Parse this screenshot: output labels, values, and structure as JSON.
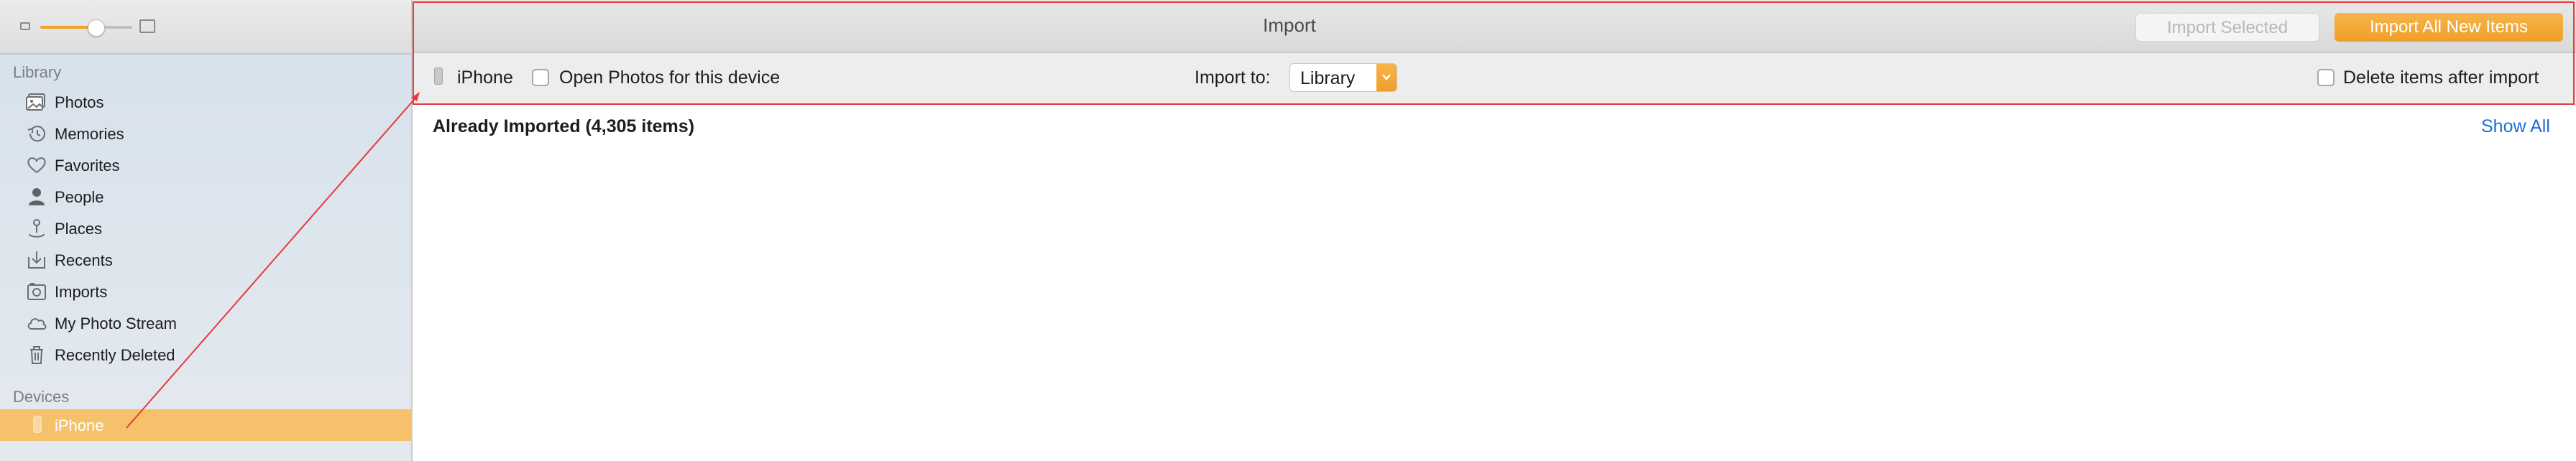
{
  "sidebar": {
    "sections": {
      "library": "Library",
      "devices": "Devices"
    },
    "library_items": [
      {
        "label": "Photos",
        "icon": "photos-icon"
      },
      {
        "label": "Memories",
        "icon": "memories-icon"
      },
      {
        "label": "Favorites",
        "icon": "heart-icon"
      },
      {
        "label": "People",
        "icon": "person-icon"
      },
      {
        "label": "Places",
        "icon": "pin-icon"
      },
      {
        "label": "Recents",
        "icon": "recents-icon"
      },
      {
        "label": "Imports",
        "icon": "imports-icon"
      },
      {
        "label": "My Photo Stream",
        "icon": "cloud-icon"
      },
      {
        "label": "Recently Deleted",
        "icon": "trash-icon"
      }
    ],
    "device_items": [
      {
        "label": "iPhone",
        "icon": "phone-icon",
        "selected": true
      }
    ],
    "zoom_level": 0.6
  },
  "header": {
    "title": "Import",
    "import_selected_label": "Import Selected",
    "import_all_label": "Import All New Items"
  },
  "toolbar": {
    "device_name": "iPhone",
    "open_photos_label": "Open Photos for this device",
    "import_to_label": "Import to:",
    "import_to_value": "Library",
    "delete_label": "Delete items after import"
  },
  "content": {
    "already_imported": "Already Imported (4,305 items)",
    "show_all": "Show All"
  },
  "colors": {
    "accent": "#f0a328",
    "selection": "#f5c26b",
    "link": "#1a6fd8",
    "annotation": "#e8393d"
  }
}
